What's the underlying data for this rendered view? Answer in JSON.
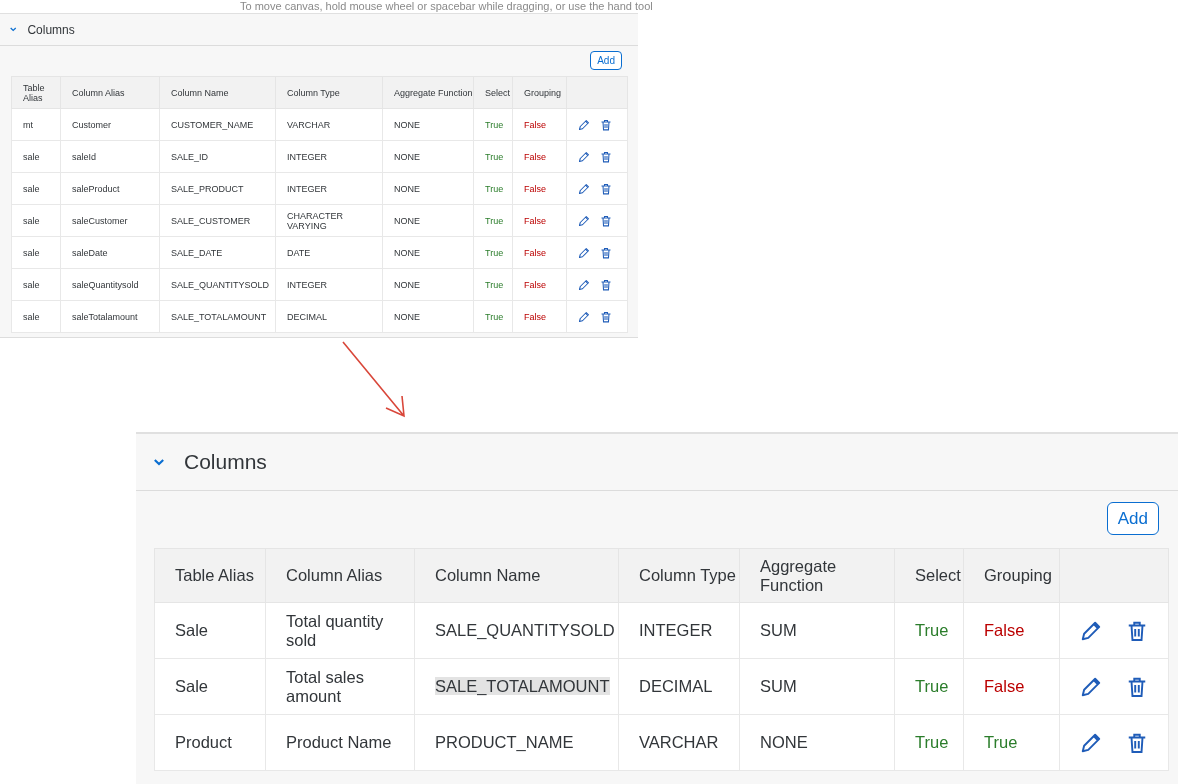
{
  "hint": "To move canvas, hold mouse wheel or spacebar while dragging, or use the hand tool",
  "panels": [
    {
      "title": "Columns",
      "expanded": true,
      "add_button": "Add",
      "columns": [
        "Table Alias",
        "Column Alias",
        "Column Name",
        "Column Type",
        "Aggregate Function",
        "Select",
        "Grouping"
      ],
      "rows": [
        {
          "table_alias": "mt",
          "column_alias": "Customer",
          "column_name": "CUSTOMER_NAME",
          "name_highlighted": false,
          "column_type": "VARCHAR",
          "aggregate": "NONE",
          "select": {
            "label": "True",
            "value": true
          },
          "grouping": {
            "label": "False",
            "value": false
          }
        },
        {
          "table_alias": "sale",
          "column_alias": "saleId",
          "column_name": "SALE_ID",
          "name_highlighted": false,
          "column_type": "INTEGER",
          "aggregate": "NONE",
          "select": {
            "label": "True",
            "value": true
          },
          "grouping": {
            "label": "False",
            "value": false
          }
        },
        {
          "table_alias": "sale",
          "column_alias": "saleProduct",
          "column_name": "SALE_PRODUCT",
          "name_highlighted": false,
          "column_type": "INTEGER",
          "aggregate": "NONE",
          "select": {
            "label": "True",
            "value": true
          },
          "grouping": {
            "label": "False",
            "value": false
          }
        },
        {
          "table_alias": "sale",
          "column_alias": "saleCustomer",
          "column_name": "SALE_CUSTOMER",
          "name_highlighted": false,
          "column_type": "CHARACTER VARYING",
          "aggregate": "NONE",
          "select": {
            "label": "True",
            "value": true
          },
          "grouping": {
            "label": "False",
            "value": false
          }
        },
        {
          "table_alias": "sale",
          "column_alias": "saleDate",
          "column_name": "SALE_DATE",
          "name_highlighted": false,
          "column_type": "DATE",
          "aggregate": "NONE",
          "select": {
            "label": "True",
            "value": true
          },
          "grouping": {
            "label": "False",
            "value": false
          }
        },
        {
          "table_alias": "sale",
          "column_alias": "saleQuantitysold",
          "column_name": "SALE_QUANTITYSOLD",
          "name_highlighted": false,
          "column_type": "INTEGER",
          "aggregate": "NONE",
          "select": {
            "label": "True",
            "value": true
          },
          "grouping": {
            "label": "False",
            "value": false
          }
        },
        {
          "table_alias": "sale",
          "column_alias": "saleTotalamount",
          "column_name": "SALE_TOTALAMOUNT",
          "name_highlighted": false,
          "column_type": "DECIMAL",
          "aggregate": "NONE",
          "select": {
            "label": "True",
            "value": true
          },
          "grouping": {
            "label": "False",
            "value": false
          }
        }
      ]
    },
    {
      "title": "Columns",
      "expanded": true,
      "add_button": "Add",
      "columns": [
        "Table Alias",
        "Column Alias",
        "Column Name",
        "Column Type",
        "Aggregate Function",
        "Select",
        "Grouping"
      ],
      "rows": [
        {
          "table_alias": "Sale",
          "column_alias": "Total quantity sold",
          "column_name": "SALE_QUANTITYSOLD",
          "name_highlighted": false,
          "column_type": "INTEGER",
          "aggregate": "SUM",
          "select": {
            "label": "True",
            "value": true
          },
          "grouping": {
            "label": "False",
            "value": false
          }
        },
        {
          "table_alias": "Sale",
          "column_alias": "Total sales amount",
          "column_name": "SALE_TOTALAMOUNT",
          "name_highlighted": true,
          "column_type": "DECIMAL",
          "aggregate": "SUM",
          "select": {
            "label": "True",
            "value": true
          },
          "grouping": {
            "label": "False",
            "value": false
          }
        },
        {
          "table_alias": "Product",
          "column_alias": "Product Name",
          "column_name": "PRODUCT_NAME",
          "name_highlighted": false,
          "column_type": "VARCHAR",
          "aggregate": "NONE",
          "select": {
            "label": "True",
            "value": true
          },
          "grouping": {
            "label": "True",
            "value": true
          }
        }
      ]
    }
  ]
}
